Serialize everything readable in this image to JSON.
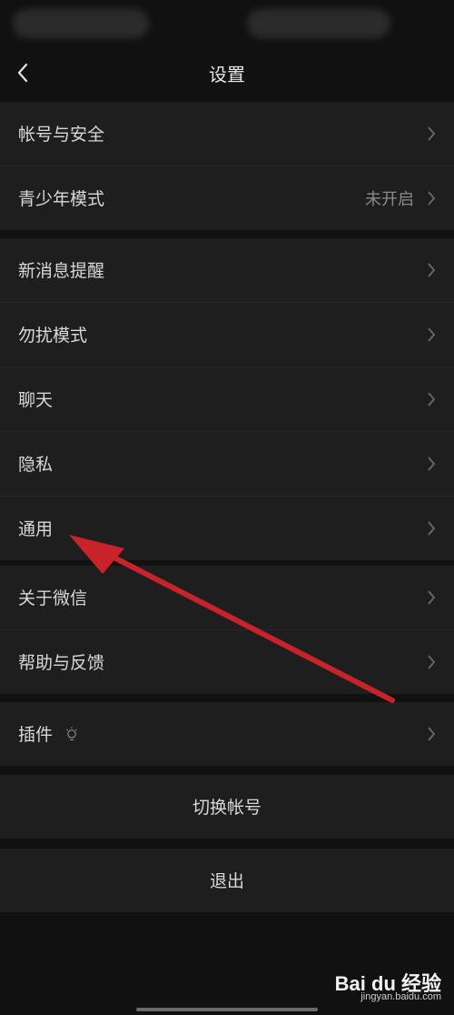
{
  "nav": {
    "title": "设置",
    "back_icon": "chevron-left-icon"
  },
  "groups": [
    {
      "items": [
        {
          "label": "帐号与安全"
        },
        {
          "label": "青少年模式",
          "value": "未开启"
        }
      ]
    },
    {
      "items": [
        {
          "label": "新消息提醒"
        },
        {
          "label": "勿扰模式"
        },
        {
          "label": "聊天"
        },
        {
          "label": "隐私"
        },
        {
          "label": "通用"
        }
      ]
    },
    {
      "items": [
        {
          "label": "关于微信"
        },
        {
          "label": "帮助与反馈"
        }
      ]
    },
    {
      "items": [
        {
          "label": "插件",
          "icon": "lightbulb-icon"
        }
      ]
    }
  ],
  "actions": {
    "switch_account": "切换帐号",
    "logout": "退出"
  },
  "annotation": {
    "color": "#c8232b",
    "points_to": "通用"
  },
  "watermark": {
    "logo": "Bai du 经验",
    "url": "jingyan.baidu.com"
  },
  "colors": {
    "background": "#111111",
    "cell": "#1e1e1e",
    "text": "#d8d8d8",
    "secondary_text": "#8a8a8a"
  }
}
